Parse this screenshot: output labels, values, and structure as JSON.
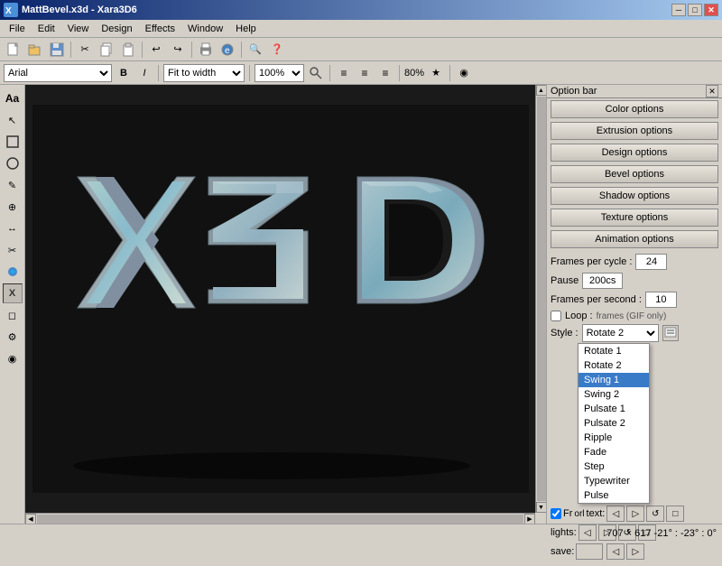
{
  "window": {
    "title": "MattBevel.x3d - Xara3D6",
    "icon": "X"
  },
  "titlebar": {
    "minimize": "─",
    "maximize": "□",
    "close": "✕"
  },
  "menu": {
    "items": [
      "File",
      "Edit",
      "View",
      "Design",
      "Effects",
      "Window",
      "Help"
    ]
  },
  "toolbar": {
    "buttons": [
      "📄",
      "📂",
      "💾",
      "✂",
      "📋",
      "📋",
      "↩",
      "↪",
      "🖨",
      "👁",
      "🔍",
      "❓"
    ]
  },
  "formatbar": {
    "font": "Arial",
    "bold": "B",
    "italic": "I",
    "fit_to_width": "Fit to width",
    "zoom": "100%",
    "zoom_pct": "80%",
    "align_buttons": [
      "≡",
      "≡",
      "≡"
    ],
    "star_icon": "★",
    "eye_icon": "◉"
  },
  "left_tools": {
    "buttons": [
      "Aa",
      "↖",
      "□",
      "◯",
      "✎",
      "⌖",
      "↕",
      "✂",
      "🎨",
      "X",
      "◻",
      "⚙",
      "◉"
    ]
  },
  "panel": {
    "header": "Option bar",
    "close": "✕",
    "buttons": [
      "Color options",
      "Extrusion options",
      "Design options",
      "Bevel options",
      "Shadow options",
      "Texture options",
      "Animation options"
    ]
  },
  "animation": {
    "frames_cycle_label": "Frames per cycle :",
    "frames_cycle_value": "24",
    "pause_label": "Pause",
    "pause_value": "200cs",
    "frames_sec_label": "Frames per second :",
    "frames_sec_value": "10",
    "loop_label": "Loop :",
    "loop_note": "frames (GIF only)",
    "style_label": "Style :",
    "style_value": "Rotate 2",
    "animation_picker_label": "Animation picker"
  },
  "style_dropdown": {
    "items": [
      "Rotate 1",
      "Rotate 2",
      "Swing 1",
      "Swing 2",
      "Pulsate 1",
      "Pulsate 2",
      "Ripple",
      "Fade",
      "Step",
      "Typewriter",
      "Pulse"
    ],
    "selected": "Swing 1"
  },
  "ctrl_rows": {
    "text_label": "text:",
    "lights_label": "lights:",
    "save_label": "save:"
  },
  "status": {
    "text": "707 × 617  -21° : -23° : 0°"
  },
  "canvas": {
    "bg_color": "#111111"
  }
}
